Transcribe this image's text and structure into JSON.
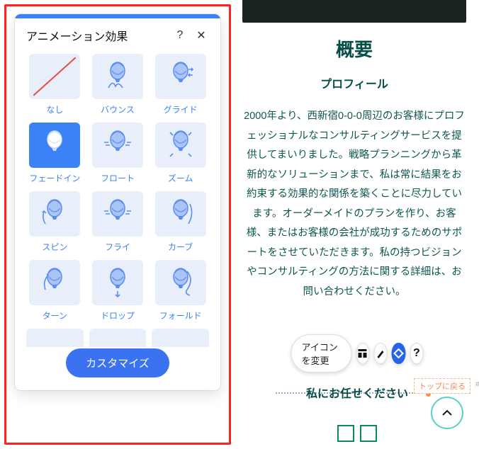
{
  "panel": {
    "title": "アニメーション効果",
    "help": "?",
    "close": "✕",
    "tiles": [
      {
        "name": "none",
        "label": "なし",
        "selected": false
      },
      {
        "name": "bounce",
        "label": "バウンス",
        "selected": false
      },
      {
        "name": "glide",
        "label": "グライド",
        "selected": false
      },
      {
        "name": "fadein",
        "label": "フェードイン",
        "selected": true
      },
      {
        "name": "float",
        "label": "フロート",
        "selected": false
      },
      {
        "name": "zoom",
        "label": "ズーム",
        "selected": false
      },
      {
        "name": "spin",
        "label": "スピン",
        "selected": false
      },
      {
        "name": "fly",
        "label": "フライ",
        "selected": false
      },
      {
        "name": "curve",
        "label": "カーブ",
        "selected": false
      },
      {
        "name": "turn",
        "label": "ターン",
        "selected": false
      },
      {
        "name": "drop",
        "label": "ドロップ",
        "selected": false
      },
      {
        "name": "fold",
        "label": "フォールド",
        "selected": false
      }
    ],
    "customize": "カスタマイズ"
  },
  "right": {
    "h1": "概要",
    "h2": "プロフィール",
    "body": "2000年より、西新宿0-0-0周辺のお客様にプロフェッショナルなコンサルティングサービスを提供してまいりました。戦略プランニングから革新的なソリューションまで、私は常に結果をお約束する効果的な関係を築くことに尽力しています。オーダーメイドのプランを作り、お客様、またはお客様の会社が成功するためのサポートをさせていただきます。私の持つビジョンやコンサルティングの方法に関する詳細は、お問い合わせください。",
    "toolbar": {
      "change_icon": "アイコンを変更"
    },
    "cta": "私にお任せください",
    "back_top": "トップに戻る"
  },
  "colors": {
    "accent": "#3b82f6",
    "teal": "#044e46"
  }
}
